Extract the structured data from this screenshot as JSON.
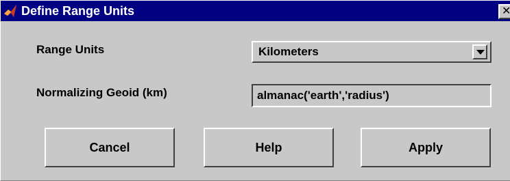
{
  "window": {
    "title": "Define Range Units",
    "title_icon": "matlab-logo-icon",
    "close_icon": "close-icon",
    "close_glyph": "✕",
    "colors": {
      "titlebar": "#000080",
      "face": "#c8c8c8",
      "title_text": "#ffffff"
    }
  },
  "form": {
    "range_units_label": "Range Units",
    "range_units_value": "Kilometers",
    "geoid_label": "Normalizing Geoid (km)",
    "geoid_value": "almanac('earth','radius')"
  },
  "buttons": {
    "cancel": "Cancel",
    "help": "Help",
    "apply": "Apply"
  }
}
